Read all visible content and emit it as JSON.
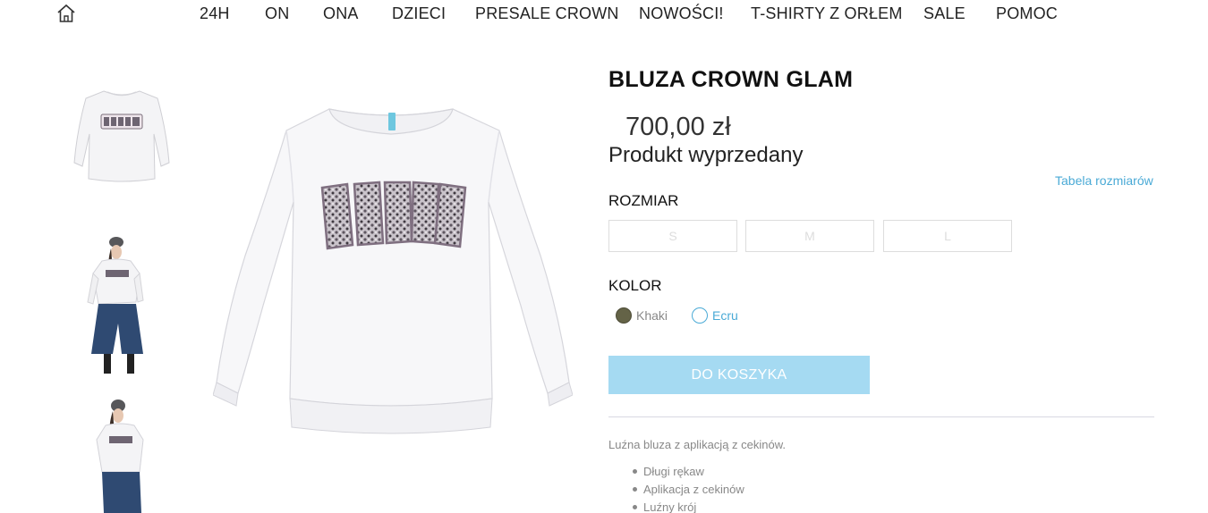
{
  "nav": {
    "home_icon": "home-icon",
    "items": [
      {
        "label": "24H"
      },
      {
        "label": "ON"
      },
      {
        "label": "ONA"
      },
      {
        "label": "DZIECI"
      },
      {
        "label": "PRESALE CROWN"
      },
      {
        "label": "NOWOŚCI!"
      },
      {
        "label": "T-SHIRTY Z ORŁEM"
      },
      {
        "label": "SALE"
      },
      {
        "label": "POMOC"
      }
    ]
  },
  "gallery": {
    "thumbnails": [
      "sweatshirt-front-photo",
      "model-wearing-sweatshirt-photo",
      "model-wearing-sweatshirt-side-photo"
    ],
    "main_image": "sweatshirt-front-photo"
  },
  "product": {
    "title": "BLUZA CROWN GLAM",
    "price": "700,00 zł",
    "availability": "Produkt wyprzedany",
    "size_chart_link": "Tabela rozmiarów",
    "size_label": "ROZMIAR",
    "sizes": [
      "S",
      "M",
      "L"
    ],
    "color_label": "KOLOR",
    "colors": [
      {
        "name": "Khaki",
        "hex": "#646347"
      },
      {
        "name": "Ecru",
        "hex": "#ffffff"
      }
    ],
    "add_to_cart": "DO KOSZYKA",
    "description": "Luźna bluza z aplikacją z cekinów.",
    "features": [
      "Długi rękaw",
      "Aplikacja z cekinów",
      "Luźny krój"
    ]
  },
  "colors": {
    "accent": "#4aaad6",
    "button_bg": "#a5daf2",
    "text": "#222222",
    "muted": "#888888"
  }
}
